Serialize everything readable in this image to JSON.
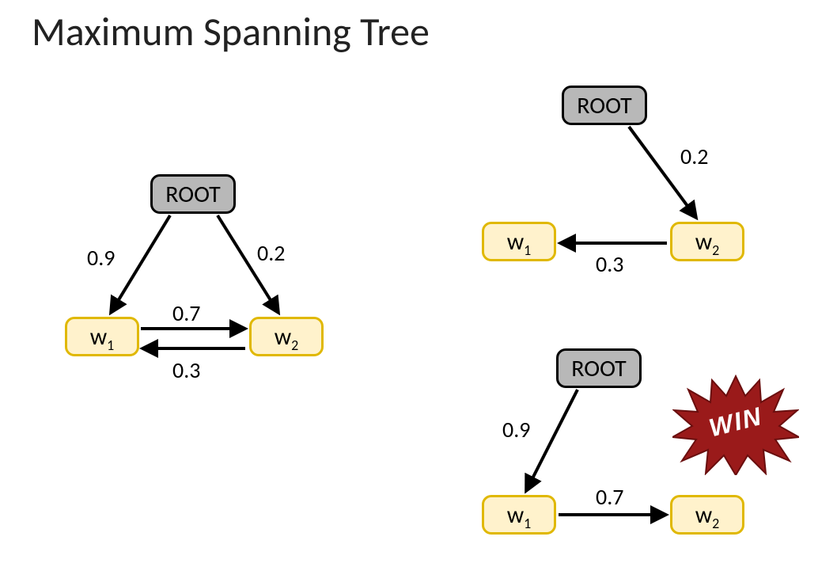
{
  "title": "Maximum Spanning Tree",
  "root_label": "ROOT",
  "w1_label_main": "w",
  "w1_label_sub": "1",
  "w2_label_main": "w",
  "w2_label_sub": "2",
  "graph_left": {
    "edge_root_w1": "0.9",
    "edge_root_w2": "0.2",
    "edge_w1_w2": "0.7",
    "edge_w2_w1": "0.3"
  },
  "tree_top_right": {
    "edge_root_w2": "0.2",
    "edge_w2_w1": "0.3"
  },
  "tree_bottom_right": {
    "edge_root_w1": "0.9",
    "edge_w1_w2": "0.7"
  },
  "win_label": "WIN"
}
